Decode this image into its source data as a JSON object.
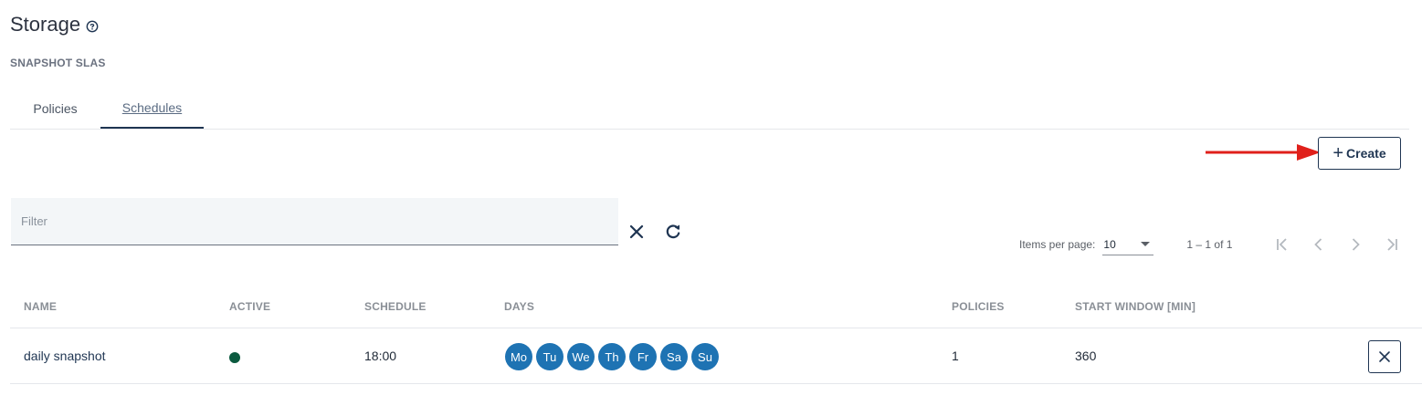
{
  "page": {
    "title": "Storage",
    "help_icon": "help-circle-icon",
    "subtitle": "SNAPSHOT SLAS"
  },
  "tabs": [
    {
      "label": "Policies",
      "active": false
    },
    {
      "label": "Schedules",
      "active": true
    }
  ],
  "toolbar": {
    "create_label": "Create",
    "create_icon": "plus-icon",
    "annotation_arrow_color": "#e0201b"
  },
  "filter": {
    "placeholder": "Filter",
    "value": "",
    "clear_icon": "close-icon",
    "refresh_icon": "refresh-icon"
  },
  "paginator": {
    "items_per_page_label": "Items per page:",
    "items_per_page_value": "10",
    "range_label": "1 – 1 of 1",
    "icons": [
      "first-page-icon",
      "previous-page-icon",
      "next-page-icon",
      "last-page-icon"
    ]
  },
  "table": {
    "columns": [
      "NAME",
      "ACTIVE",
      "SCHEDULE",
      "DAYS",
      "POLICIES",
      "START WINDOW [MIN]"
    ],
    "rows": [
      {
        "name": "daily snapshot",
        "active": true,
        "schedule": "18:00",
        "days": [
          "Mo",
          "Tu",
          "We",
          "Th",
          "Fr",
          "Sa",
          "Su"
        ],
        "policies": "1",
        "start_window": "360",
        "delete_icon": "close-icon"
      }
    ]
  },
  "colors": {
    "accent": "#1f3552",
    "day_badge": "#1e73b3",
    "active_dot": "#0b5a3f"
  }
}
